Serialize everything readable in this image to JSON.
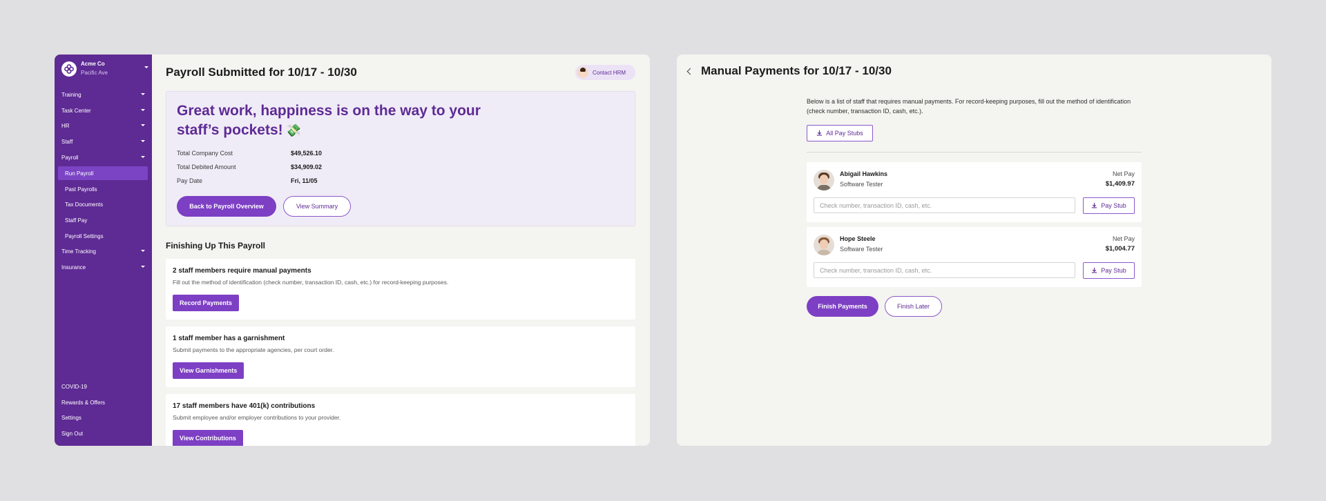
{
  "left_window": {
    "org": {
      "name": "Acme Co",
      "location": "Pacific Ave"
    },
    "sidebar": {
      "items": [
        {
          "label": "Training"
        },
        {
          "label": "Task Center"
        },
        {
          "label": "HR"
        },
        {
          "label": "Staff"
        },
        {
          "label": "Payroll"
        },
        {
          "label": "Time Tracking"
        },
        {
          "label": "Insurance"
        }
      ],
      "payroll_sub": [
        {
          "label": "Run Payroll",
          "active": true
        },
        {
          "label": "Past Payrolls"
        },
        {
          "label": "Tax Documents"
        },
        {
          "label": "Staff Pay"
        },
        {
          "label": "Payroll Settings"
        }
      ],
      "bottom": [
        {
          "label": "COVID-19"
        },
        {
          "label": "Rewards & Offers"
        },
        {
          "label": "Settings"
        },
        {
          "label": "Sign Out"
        }
      ]
    },
    "header": {
      "title": "Payroll Submitted for 10/17 - 10/30",
      "contact_label": "Contact HRM"
    },
    "hero": {
      "message": "Great work, happiness is on the way to your staff’s pockets!",
      "emoji": "💸",
      "stats": [
        {
          "label": "Total Company Cost",
          "value": "$49,526.10"
        },
        {
          "label": "Total Debited Amount",
          "value": "$34,909.02"
        },
        {
          "label": "Pay Date",
          "value": "Fri, 11/05"
        }
      ],
      "primary_button": "Back to Payroll Overview",
      "secondary_button": "View Summary"
    },
    "finishing": {
      "title": "Finishing Up This Payroll",
      "tasks": [
        {
          "title": "2 staff members require manual payments",
          "desc": "Fill out the method of identification (check number, transaction ID, cash, etc.) for record-keeping purposes.",
          "button": "Record Payments"
        },
        {
          "title": "1 staff member has a garnishment",
          "desc": "Submit payments to the appropriate agencies, per court order.",
          "button": "View Garnishments"
        },
        {
          "title": "17 staff members have 401(k) contributions",
          "desc": "Submit employee and/or employer contributions to your provider.",
          "button": "View Contributions"
        }
      ]
    }
  },
  "right_window": {
    "title": "Manual Payments for 10/17 - 10/30",
    "intro": "Below is a list of staff that requires manual payments. For record-keeping purposes, fill out the method of identification (check number, transaction ID, cash, etc.).",
    "all_stubs_label": "All Pay Stubs",
    "net_pay_label": "Net Pay",
    "input_placeholder": "Check number, transaction ID, cash, etc.",
    "stub_label": "Pay Stub",
    "payments": [
      {
        "name": "Abigail Hawkins",
        "role": "Software Tester",
        "net_pay": "$1,409.97"
      },
      {
        "name": "Hope Steele",
        "role": "Software Tester",
        "net_pay": "$1,004.77"
      }
    ],
    "finish_label": "Finish Payments",
    "later_label": "Finish Later"
  },
  "colors": {
    "brand": "#5e2a94",
    "accent": "#7d3fc4",
    "active_nav": "#7b44c4",
    "hero_bg": "#f0ecf7"
  },
  "icons": [
    "acme-logo-icon",
    "chevron-down-icon",
    "back-chevron-icon",
    "download-icon",
    "money-wings-emoji"
  ]
}
